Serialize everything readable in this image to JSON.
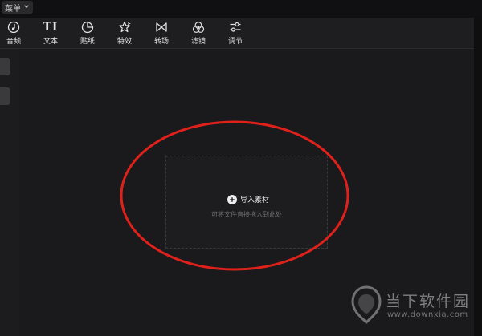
{
  "menu": {
    "label": "菜单"
  },
  "toolbar": {
    "items": [
      {
        "label": "音频",
        "icon": "audio-icon"
      },
      {
        "label": "文本",
        "icon": "text-icon",
        "glyph": "TI"
      },
      {
        "label": "贴纸",
        "icon": "sticker-icon"
      },
      {
        "label": "特效",
        "icon": "effects-icon"
      },
      {
        "label": "转场",
        "icon": "transition-icon"
      },
      {
        "label": "滤镜",
        "icon": "filter-icon"
      },
      {
        "label": "调节",
        "icon": "adjust-icon"
      }
    ]
  },
  "media": {
    "import_label": "导入素材",
    "hint": "可将文件直接拖入到此处"
  },
  "watermark": {
    "name": "当下软件园",
    "url": "www.downxia.com"
  },
  "colors": {
    "background": "#1c1c1e",
    "annotation": "#e0211b",
    "text": "#e3e3e3"
  }
}
